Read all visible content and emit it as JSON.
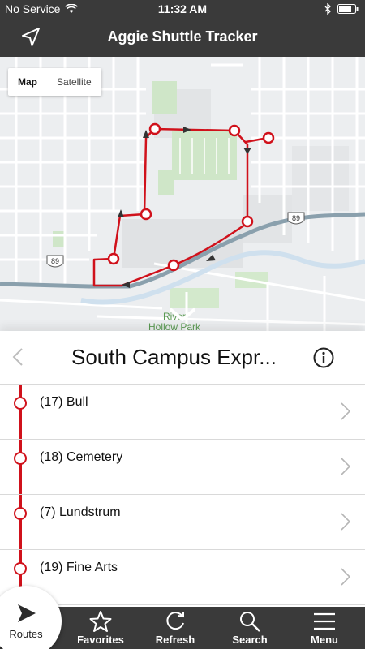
{
  "status": {
    "carrier": "No Service",
    "time": "11:32 AM"
  },
  "nav": {
    "title": "Aggie Shuttle Tracker"
  },
  "map": {
    "toggle_map": "Map",
    "toggle_satellite": "Satellite",
    "highway_label": "89",
    "park_label_line1": "River",
    "park_label_line2": "Hollow Park",
    "route_color": "#d0111b"
  },
  "route": {
    "name": "South Campus Expr..."
  },
  "stops": [
    {
      "label": "(17) Bull"
    },
    {
      "label": "(18) Cemetery"
    },
    {
      "label": "(7) Lundstrum"
    },
    {
      "label": "(19) Fine Arts"
    }
  ],
  "tabs": {
    "routes": "Routes",
    "favorites": "Favorites",
    "refresh": "Refresh",
    "search": "Search",
    "menu": "Menu"
  }
}
